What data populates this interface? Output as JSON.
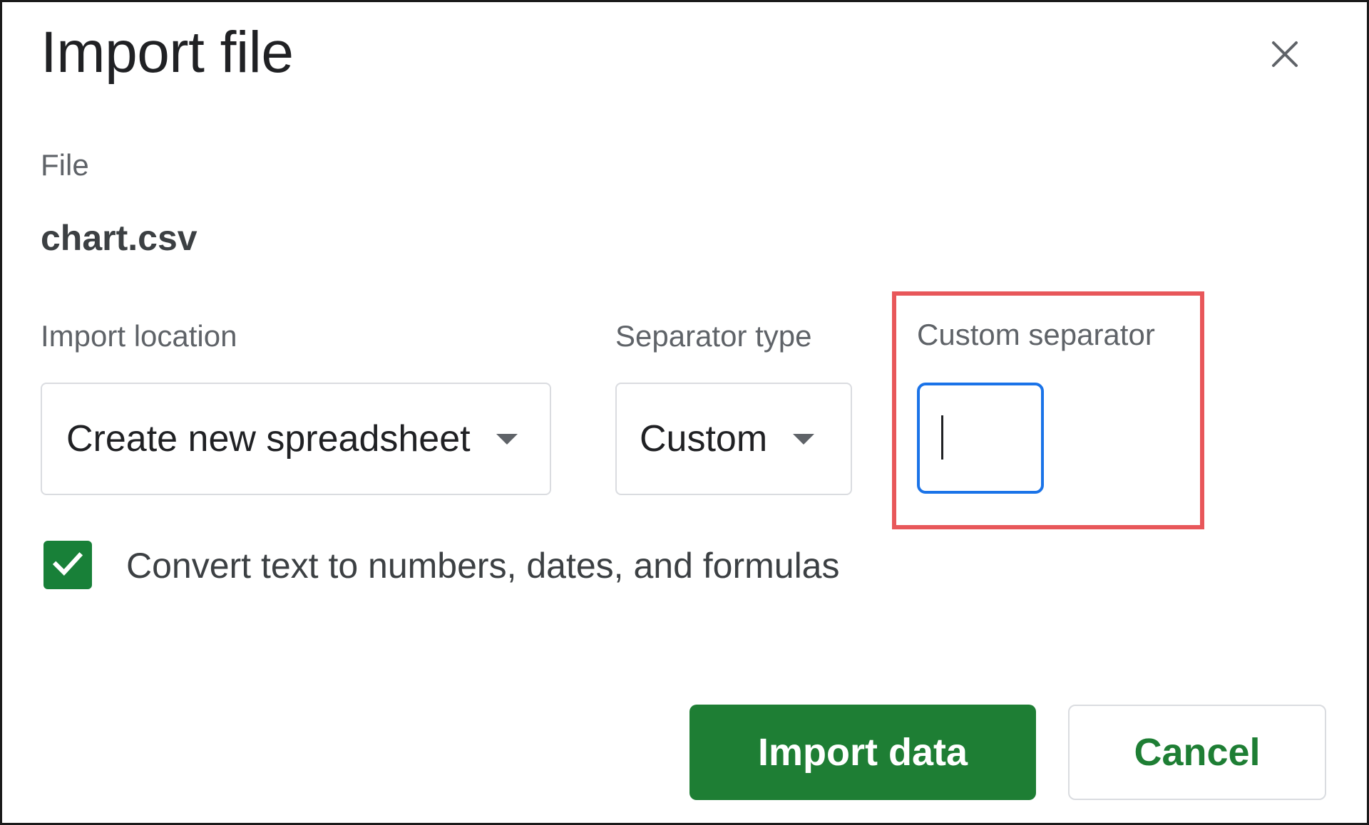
{
  "dialog": {
    "title": "Import file",
    "close_icon": "close-icon"
  },
  "file": {
    "label": "File",
    "name": "chart.csv"
  },
  "import_location": {
    "label": "Import location",
    "value": "Create new spreadsheet"
  },
  "separator_type": {
    "label": "Separator type",
    "value": "Custom"
  },
  "custom_separator": {
    "label": "Custom separator",
    "value": "",
    "highlight_color": "#e8575a"
  },
  "convert_option": {
    "label": "Convert text to numbers, dates, and formulas",
    "checked": true
  },
  "actions": {
    "import_label": "Import data",
    "cancel_label": "Cancel"
  },
  "colors": {
    "primary_green": "#1e7e34",
    "focus_blue": "#1a73e8"
  }
}
